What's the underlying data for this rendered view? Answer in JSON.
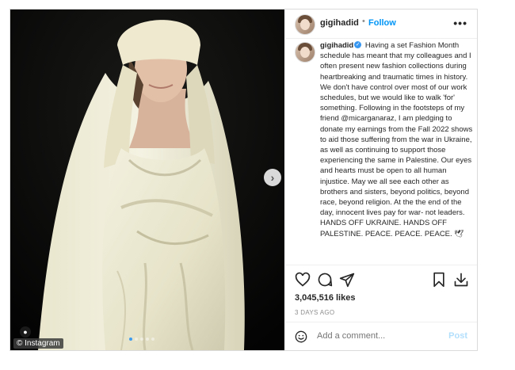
{
  "post": {
    "watermark": "© Instagram",
    "user_tag_icon": "person-icon",
    "carousel": {
      "dots": 5,
      "active_index": 0
    }
  },
  "header": {
    "username": "gigihadid",
    "separator": "•",
    "follow_label": "Follow",
    "more_label": "•••"
  },
  "caption": {
    "username": "gigihadid",
    "text": "Having a set Fashion Month schedule has meant that my colleagues and I often present new fashion collections during heartbreaking and traumatic times in history. We don't have control over most of our work schedules, but we would like to walk 'for' something. Following in the footsteps of my friend @micarganaraz, I am pledging to donate my earnings from the Fall 2022 shows to aid those suffering from the war in Ukraine, as well as continuing to support those experiencing the same in Palestine. Our eyes and hearts must be open to all human injustice. May we all see each other as brothers and sisters, beyond politics, beyond race, beyond religion. At the the end of the day, innocent lives pay for war- not leaders. HANDS OFF UKRAINE. HANDS OFF PALESTINE. PEACE. PEACE. PEACE. 🕊"
  },
  "actions": {
    "icons": [
      "heart-icon",
      "comment-icon",
      "share-icon",
      "bookmark-icon",
      "download-icon"
    ]
  },
  "likes": "3,045,516 likes",
  "date": "3 DAYS AGO",
  "comment": {
    "placeholder": "Add a comment...",
    "post_label": "Post"
  },
  "colors": {
    "link_blue": "#0095f6",
    "post_disabled": "#b2dffc",
    "verified_blue": "#3897f0",
    "border": "#dbdbdb"
  }
}
